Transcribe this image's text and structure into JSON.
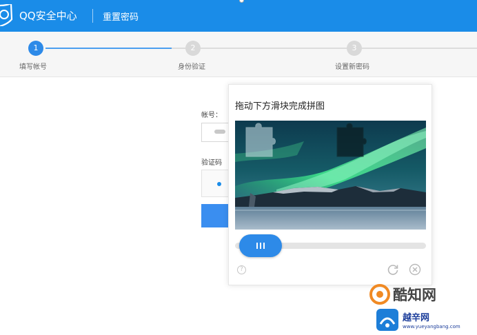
{
  "header": {
    "app_title": "QQ安全中心",
    "page_title": "重置密码",
    "logo_icon": "qq-shield-logo-icon",
    "color": "#1a8ce8"
  },
  "steps": [
    {
      "number": "1",
      "label": "填写帐号",
      "state": "active"
    },
    {
      "number": "2",
      "label": "身份验证",
      "state": "inactive"
    },
    {
      "number": "3",
      "label": "设置新密码",
      "state": "inactive"
    }
  ],
  "form": {
    "account_label": "帐号：",
    "captcha_label": "验证码"
  },
  "puzzle": {
    "title": "拖动下方滑块完成拼图",
    "slider_progress": 0,
    "help_icon": "question-circle-icon",
    "refresh_icon": "refresh-icon",
    "close_icon": "close-circle-icon",
    "accent_color": "#2d8ae8"
  },
  "watermarks": {
    "site1": "酷知网",
    "site2": "越辛网",
    "site2_url": "www.yueyangbang.com"
  }
}
